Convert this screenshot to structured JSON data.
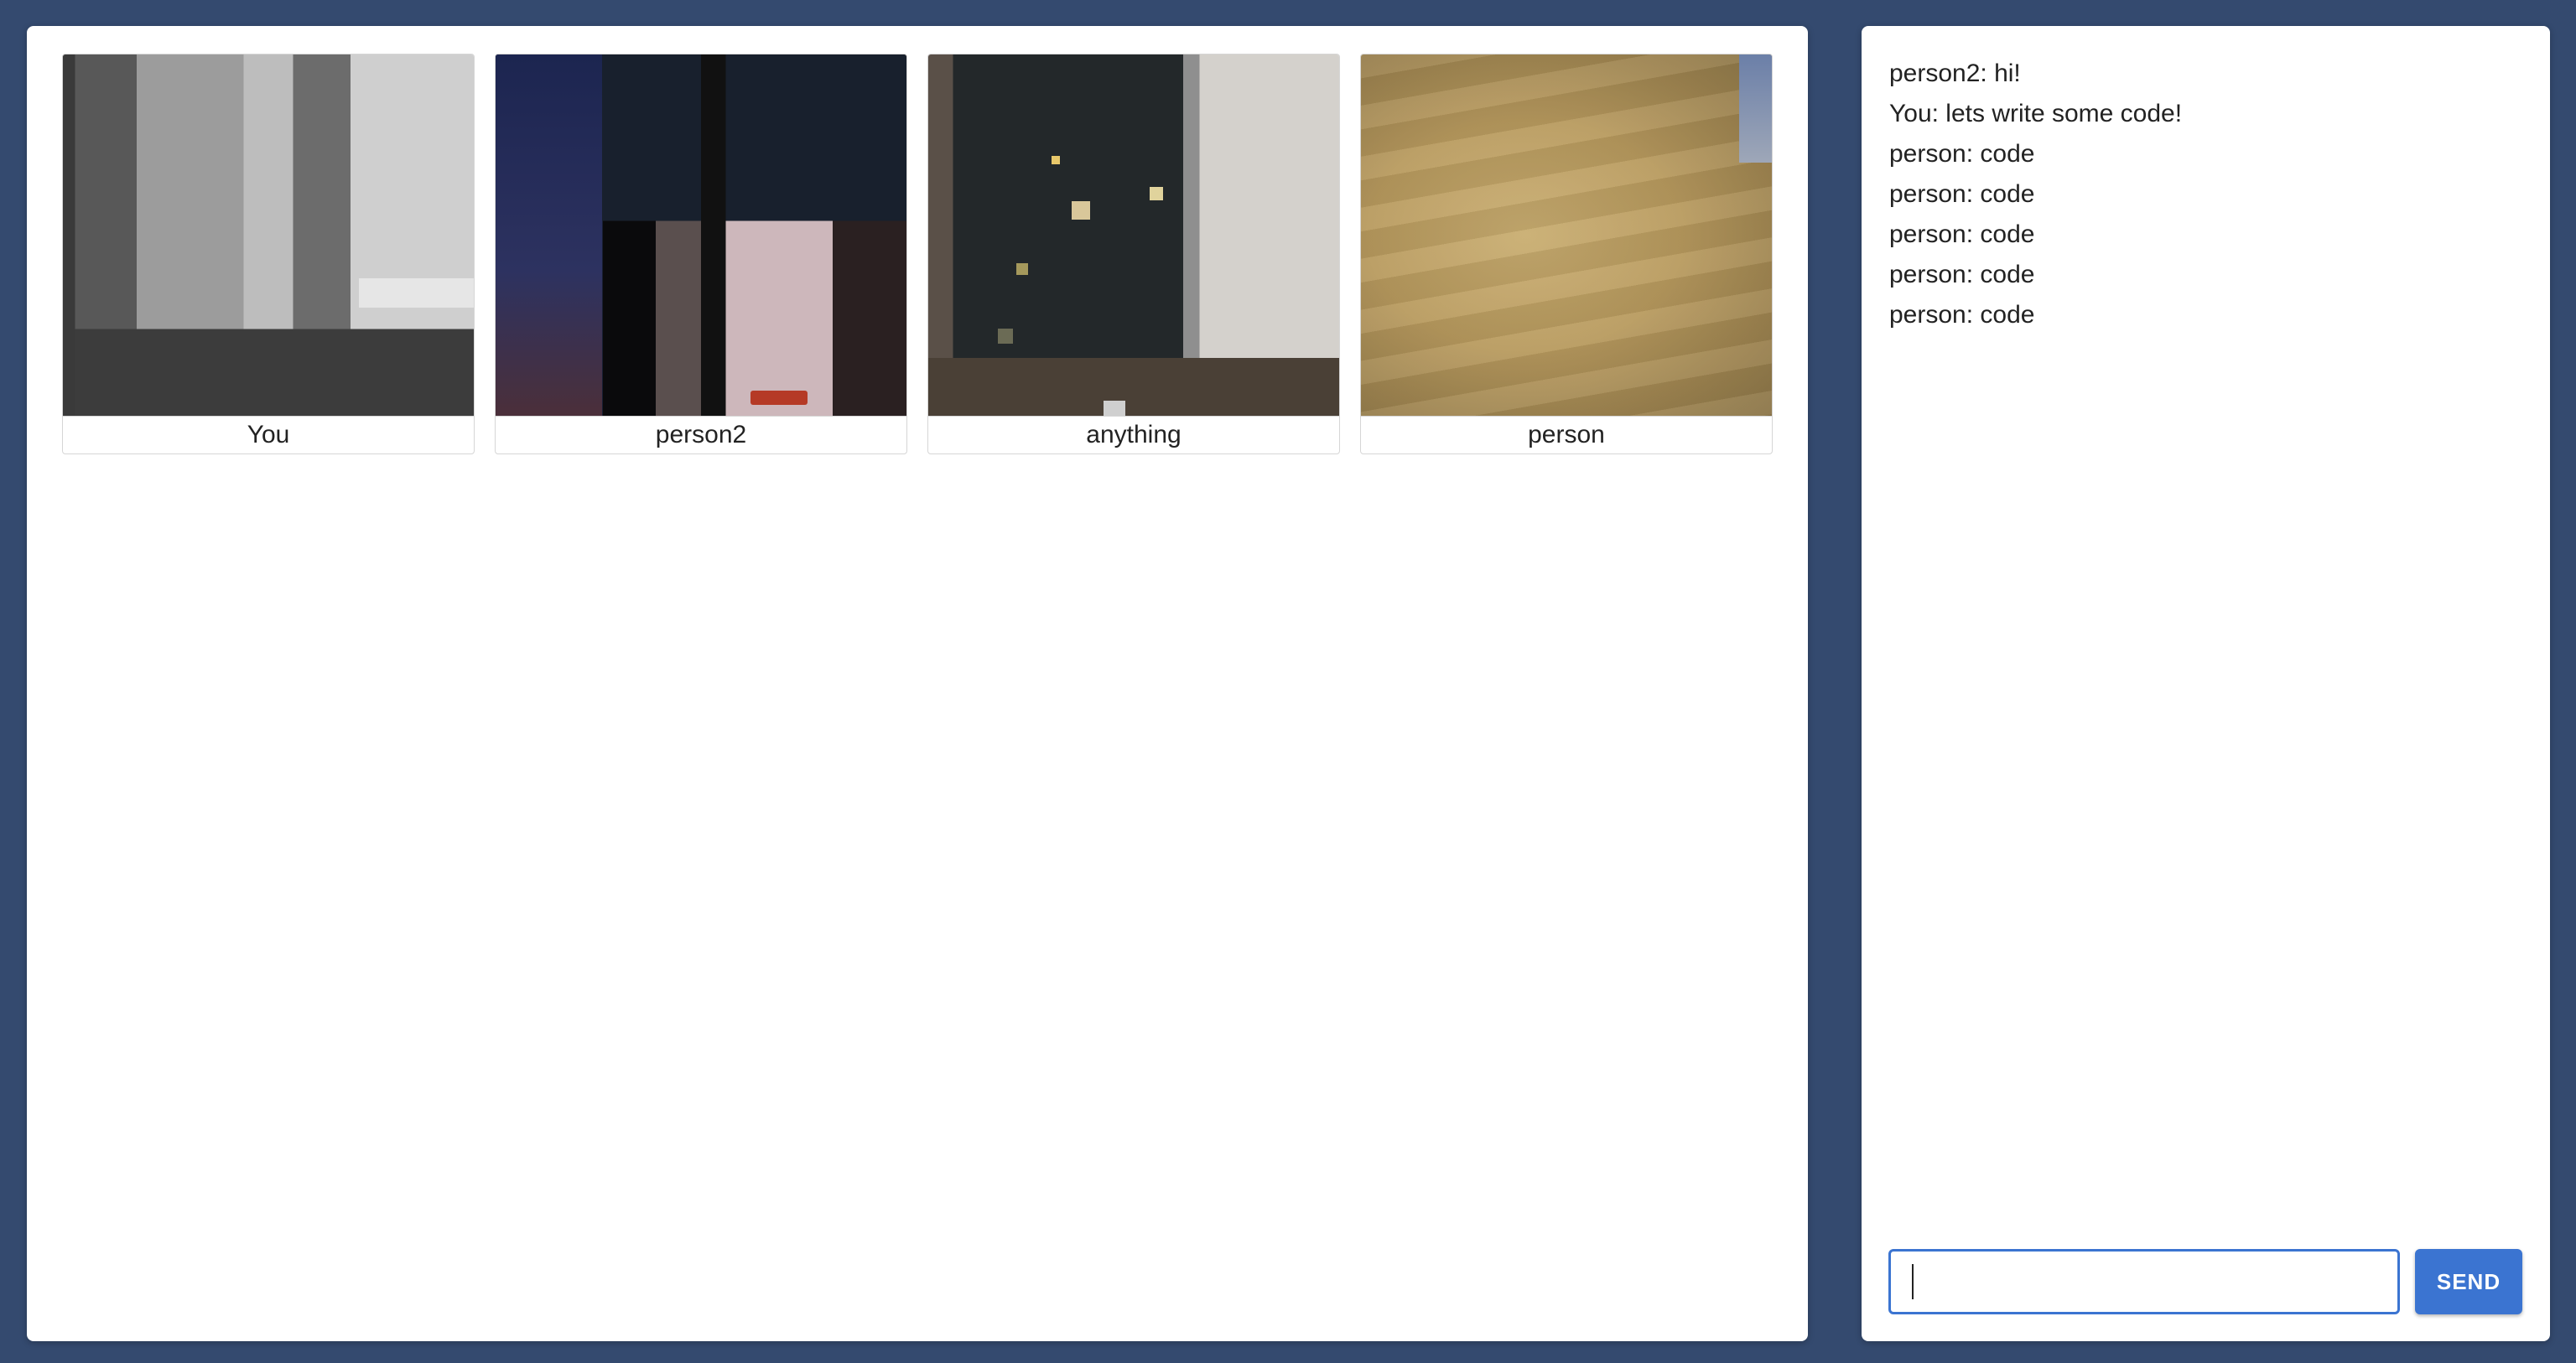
{
  "video_grid": {
    "tiles": [
      {
        "label": "You"
      },
      {
        "label": "person2"
      },
      {
        "label": "anything"
      },
      {
        "label": "person"
      }
    ]
  },
  "chat": {
    "messages": [
      "person2: hi!",
      "You: lets write some code!",
      "person: code",
      "person: code",
      "person: code",
      "person: code",
      "person: code"
    ],
    "input_value": "",
    "send_label": "SEND"
  },
  "colors": {
    "background": "#344a6f",
    "accent": "#3b74d1",
    "panel": "#ffffff"
  }
}
